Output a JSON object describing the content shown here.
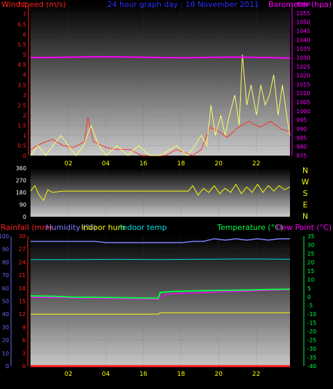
{
  "panel1": {
    "title_left": "Windspeed (m/s)",
    "title_center": "24 hour graph day : 10 November 2011",
    "title_right": "Barometer (hpa)"
  },
  "panel3": {
    "legend": {
      "rainfall": "Rainfall (mm)",
      "humidity": "Humidity (%)",
      "indoor_hum": "Indoor hum",
      "indoor_temp": "Indoor temp",
      "temperature": "Temperature (°C)",
      "dew_point": "Dew Point (°C)"
    }
  },
  "colors": {
    "wind_avg": "#ff2a2a",
    "wind_gust": "#ffff66",
    "barometer": "#ff00ff",
    "direction": "#ffff00",
    "rainfall": "#ff2020",
    "humidity": "#8080ff",
    "indoor_hum": "#ffff00",
    "indoor_temp": "#00e0e0",
    "temperature": "#00ff44",
    "dew_point": "#ff00ff",
    "tick_red": "#ff2020",
    "tick_mag": "#ff00ff",
    "tick_blue": "#6a6aff",
    "tick_yellow": "#ffff00",
    "tick_green": "#00ff44",
    "xtick": "#ffff00"
  },
  "chart_data": [
    {
      "type": "line",
      "title": "24 hour graph day : 10 November 2011",
      "xlabel": "",
      "x_ticks": [
        "02",
        "04",
        "16",
        "18",
        "20",
        "22"
      ],
      "y_left": {
        "label": "Windspeed (m/s)",
        "ticks": [
          "0",
          "0.5",
          "1",
          "1.5",
          "2",
          "2.5",
          "3",
          "3.5",
          "4",
          "4.5",
          "5",
          "5.5",
          "6",
          "6.5",
          "7",
          "7.5"
        ],
        "range": [
          0,
          7.5
        ]
      },
      "y_right": {
        "label": "Barometer (hpa)",
        "ticks": [
          "975",
          "980",
          "985",
          "990",
          "995",
          "1000",
          "1005",
          "1010",
          "1015",
          "1020",
          "1025",
          "1030",
          "1035",
          "1040",
          "1045",
          "1050",
          "1055",
          "1060"
        ],
        "range": [
          975,
          1060
        ]
      },
      "series": [
        {
          "name": "Barometer",
          "axis": "right",
          "points": [
            [
              0,
              1030.0
            ],
            [
              2,
              1030.1
            ],
            [
              4,
              1030.3
            ],
            [
              6,
              1030.5
            ],
            [
              8,
              1030.4
            ],
            [
              10,
              1030.2
            ],
            [
              12,
              1030.0
            ],
            [
              14,
              1029.9
            ],
            [
              16,
              1030.1
            ],
            [
              18,
              1030.3
            ],
            [
              20,
              1030.2
            ],
            [
              22,
              1030.0
            ],
            [
              24,
              1029.8
            ]
          ]
        },
        {
          "name": "Wind average",
          "axis": "left",
          "points": [
            [
              0,
              0.3
            ],
            [
              1,
              0.6
            ],
            [
              2,
              0.8
            ],
            [
              3,
              0.5
            ],
            [
              4,
              0.4
            ],
            [
              5,
              0.7
            ],
            [
              5.3,
              1.9
            ],
            [
              5.8,
              0.7
            ],
            [
              7,
              0.4
            ],
            [
              8,
              0.3
            ],
            [
              9.2,
              0.3
            ],
            [
              10.3,
              0.0
            ],
            [
              12.5,
              0.0
            ],
            [
              13.5,
              0.3
            ],
            [
              15,
              0.0
            ],
            [
              15.8,
              0.3
            ],
            [
              16.6,
              1.4
            ],
            [
              17.4,
              1.2
            ],
            [
              18.2,
              0.9
            ],
            [
              19.2,
              1.4
            ],
            [
              20.2,
              1.7
            ],
            [
              21.2,
              1.4
            ],
            [
              22.2,
              1.7
            ],
            [
              23.2,
              1.3
            ],
            [
              24,
              1.2
            ]
          ]
        },
        {
          "name": "Wind gust",
          "axis": "left",
          "points": [
            [
              0,
              0.0
            ],
            [
              0.7,
              0.5
            ],
            [
              1.4,
              0.0
            ],
            [
              2.1,
              0.5
            ],
            [
              2.8,
              1.0
            ],
            [
              3.5,
              0.5
            ],
            [
              4.2,
              0.0
            ],
            [
              4.9,
              0.5
            ],
            [
              5.6,
              1.5
            ],
            [
              6.3,
              0.5
            ],
            [
              7.0,
              0.0
            ],
            [
              8.0,
              0.5
            ],
            [
              9.0,
              0.0
            ],
            [
              10.0,
              0.5
            ],
            [
              11.0,
              0.0
            ],
            [
              12.0,
              0.0
            ],
            [
              13.5,
              0.5
            ],
            [
              14.5,
              0.0
            ],
            [
              15.2,
              0.5
            ],
            [
              15.8,
              1.0
            ],
            [
              16.3,
              0.5
            ],
            [
              16.7,
              2.5
            ],
            [
              17.1,
              1.0
            ],
            [
              17.6,
              2.0
            ],
            [
              18.0,
              1.0
            ],
            [
              18.4,
              2.0
            ],
            [
              18.9,
              3.0
            ],
            [
              19.3,
              1.5
            ],
            [
              19.6,
              5.0
            ],
            [
              20.0,
              2.5
            ],
            [
              20.4,
              3.5
            ],
            [
              20.9,
              2.0
            ],
            [
              21.3,
              3.5
            ],
            [
              21.7,
              2.5
            ],
            [
              22.1,
              3.0
            ],
            [
              22.5,
              4.0
            ],
            [
              22.9,
              2.0
            ],
            [
              23.3,
              3.5
            ],
            [
              23.7,
              2.0
            ],
            [
              24.0,
              1.0
            ]
          ]
        },
        {
          "name": "Wind direction",
          "axis": "dir",
          "points": [
            [
              0,
              190
            ],
            [
              0.4,
              230
            ],
            [
              0.8,
              160
            ],
            [
              1.2,
              120
            ],
            [
              1.6,
              200
            ],
            [
              2.0,
              180
            ],
            [
              3.0,
              190
            ],
            [
              8.0,
              190
            ],
            [
              14.6,
              190
            ],
            [
              15.0,
              230
            ],
            [
              15.5,
              160
            ],
            [
              16.0,
              210
            ],
            [
              16.5,
              180
            ],
            [
              17.0,
              230
            ],
            [
              17.5,
              170
            ],
            [
              18.0,
              210
            ],
            [
              18.5,
              180
            ],
            [
              19.0,
              240
            ],
            [
              19.5,
              170
            ],
            [
              20.0,
              220
            ],
            [
              20.5,
              180
            ],
            [
              21.0,
              240
            ],
            [
              21.5,
              180
            ],
            [
              22.0,
              230
            ],
            [
              22.5,
              190
            ],
            [
              23.0,
              230
            ],
            [
              23.5,
              200
            ],
            [
              24.0,
              220
            ]
          ]
        }
      ]
    },
    {
      "type": "line",
      "title": "",
      "x_ticks": [],
      "y_left": {
        "label": "",
        "ticks": [
          "0",
          "90",
          "180",
          "270",
          "360"
        ],
        "range": [
          0,
          360
        ]
      },
      "y_right_labels": [
        "N",
        "W",
        "S",
        "E",
        "N"
      ]
    },
    {
      "type": "line",
      "title": "",
      "xlabel": "",
      "x_ticks": [
        "02",
        "04",
        "16",
        "18",
        "20",
        "22"
      ],
      "y_left_outer": {
        "label": "Humidity (%)",
        "ticks": [
          "0",
          "10",
          "20",
          "30",
          "40",
          "50",
          "60",
          "70",
          "80",
          "90",
          "100"
        ],
        "range": [
          0,
          100
        ]
      },
      "y_left_inner": {
        "label": "Rainfall (mm)",
        "ticks": [
          "0",
          "3",
          "6",
          "9",
          "12",
          "15",
          "18",
          "21",
          "24",
          "27",
          "30"
        ],
        "range": [
          0,
          30
        ]
      },
      "y_right": {
        "label": "Temperature (°C)",
        "ticks": [
          "-40",
          "-35",
          "-30",
          "-25",
          "-20",
          "-15",
          "-10",
          "-5",
          "0",
          "5",
          "10",
          "15",
          "20",
          "25",
          "30",
          "35"
        ],
        "range": [
          -40,
          35
        ]
      },
      "series": [
        {
          "name": "Humidity",
          "axis": "humidity",
          "points": [
            [
              0,
              96
            ],
            [
              2,
              96
            ],
            [
              4,
              96
            ],
            [
              6,
              96
            ],
            [
              7,
              95
            ],
            [
              8,
              95
            ],
            [
              10,
              95
            ],
            [
              12,
              95
            ],
            [
              14,
              95
            ],
            [
              15,
              96
            ],
            [
              16,
              96
            ],
            [
              17,
              98
            ],
            [
              18,
              97
            ],
            [
              19,
              98
            ],
            [
              20,
              97
            ],
            [
              21,
              98
            ],
            [
              22,
              97
            ],
            [
              23,
              98
            ],
            [
              24,
              98
            ]
          ]
        },
        {
          "name": "Indoor temp",
          "axis": "temp",
          "points": [
            [
              0,
              21.5
            ],
            [
              4,
              21.5
            ],
            [
              8,
              21.6
            ],
            [
              12,
              21.5
            ],
            [
              16,
              21.7
            ],
            [
              20,
              21.8
            ],
            [
              24,
              21.7
            ]
          ]
        },
        {
          "name": "Temperature",
          "axis": "temp",
          "points": [
            [
              0,
              0.5
            ],
            [
              2,
              0.3
            ],
            [
              4,
              -0.2
            ],
            [
              6,
              -0.3
            ],
            [
              8,
              -0.5
            ],
            [
              10,
              -0.7
            ],
            [
              11.8,
              -0.9
            ],
            [
              12.0,
              2.5
            ],
            [
              13,
              3.0
            ],
            [
              14,
              3.2
            ],
            [
              16,
              3.5
            ],
            [
              18,
              3.7
            ],
            [
              20,
              3.9
            ],
            [
              22,
              4.2
            ],
            [
              24,
              4.4
            ]
          ]
        },
        {
          "name": "Dew Point",
          "axis": "temp",
          "points": [
            [
              0,
              -0.3
            ],
            [
              3,
              -0.5
            ],
            [
              6,
              -0.9
            ],
            [
              9,
              -1.1
            ],
            [
              11.8,
              -1.4
            ],
            [
              12.5,
              1.5
            ],
            [
              14,
              2.0
            ],
            [
              16,
              2.4
            ],
            [
              18,
              2.9
            ],
            [
              20,
              3.3
            ],
            [
              22,
              3.7
            ],
            [
              24,
              4.1
            ]
          ]
        },
        {
          "name": "Indoor hum",
          "axis": "humidity",
          "points": [
            [
              0,
              40
            ],
            [
              6,
              40
            ],
            [
              11.8,
              40
            ],
            [
              12.0,
              41
            ],
            [
              18,
              41
            ],
            [
              24,
              41
            ]
          ]
        },
        {
          "name": "Rainfall",
          "axis": "rain",
          "points": [
            [
              0,
              0
            ],
            [
              24,
              0
            ]
          ]
        }
      ]
    }
  ]
}
